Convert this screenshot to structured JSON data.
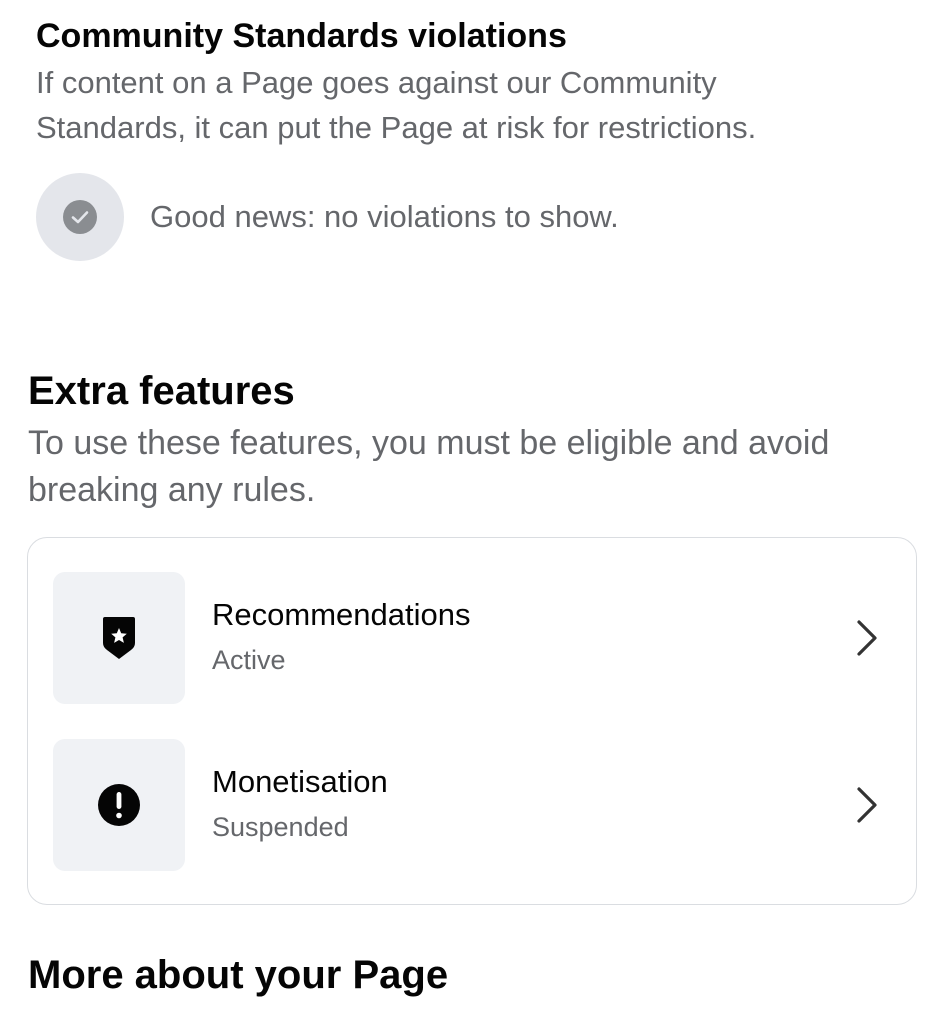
{
  "community_standards": {
    "title": "Community Standards violations",
    "description": "If content on a Page goes against our Community Standards, it can put the Page at risk for restrictions.",
    "status_icon": "checkmark-circle-icon",
    "status_text": "Good news: no violations to show."
  },
  "extra_features": {
    "title": "Extra features",
    "description": "To use these features, you must be eligible and avoid breaking any rules.",
    "items": [
      {
        "label": "Recommendations",
        "status": "Active",
        "icon": "shield-star-icon"
      },
      {
        "label": "Monetisation",
        "status": "Suspended",
        "icon": "exclamation-circle-icon"
      }
    ]
  },
  "more_about": {
    "title": "More about your Page"
  },
  "colors": {
    "primary_text": "#050505",
    "secondary_text": "#65676b",
    "icon_box_bg": "#f0f2f5",
    "status_circle_bg": "#e4e6eb",
    "card_border": "#dadde1"
  }
}
